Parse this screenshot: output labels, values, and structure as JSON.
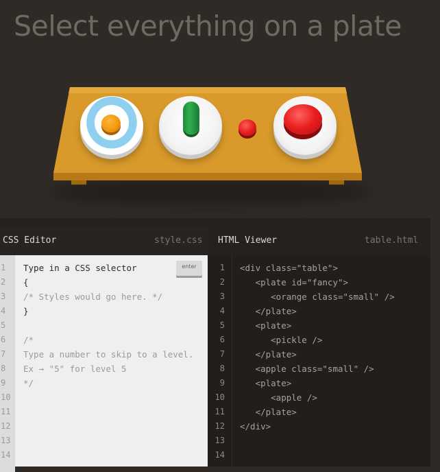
{
  "page": {
    "title": "Select everything on a plate"
  },
  "scene": {
    "items": [
      {
        "type": "plate",
        "id": "fancy",
        "contains": "orange small"
      },
      {
        "type": "plate",
        "contains": "pickle"
      },
      {
        "type": "apple",
        "class": "small"
      },
      {
        "type": "plate",
        "contains": "apple"
      }
    ]
  },
  "css_editor": {
    "title": "CSS Editor",
    "filename": "style.css",
    "enter_label": "enter",
    "line_numbers": [
      "1",
      "2",
      "3",
      "4",
      "5",
      "6",
      "7",
      "8",
      "9",
      "10",
      "11",
      "12",
      "13",
      "14"
    ],
    "lines": [
      "Type in a CSS selector",
      "{",
      "/* Styles would go here. */",
      "}",
      "",
      "/*",
      "Type a number to skip to a level.",
      "Ex → \"5\" for level 5",
      "*/"
    ]
  },
  "html_viewer": {
    "title": "HTML Viewer",
    "filename": "table.html",
    "line_numbers": [
      "1",
      "2",
      "3",
      "4",
      "5",
      "6",
      "7",
      "8",
      "9",
      "10",
      "11",
      "12",
      "13",
      "14"
    ],
    "lines": [
      "<div class=\"table\">",
      "   <plate id=\"fancy\">",
      "      <orange class=\"small\" />",
      "   </plate>",
      "   <plate>",
      "      <pickle />",
      "   </plate>",
      "   <apple class=\"small\" />",
      "   <plate>",
      "      <apple />",
      "   </plate>",
      "</div>"
    ]
  },
  "colors": {
    "background": "#2f2a25",
    "table": "#d99a2b",
    "editor_bg": "#efefef",
    "viewer_bg": "#211e1b"
  }
}
